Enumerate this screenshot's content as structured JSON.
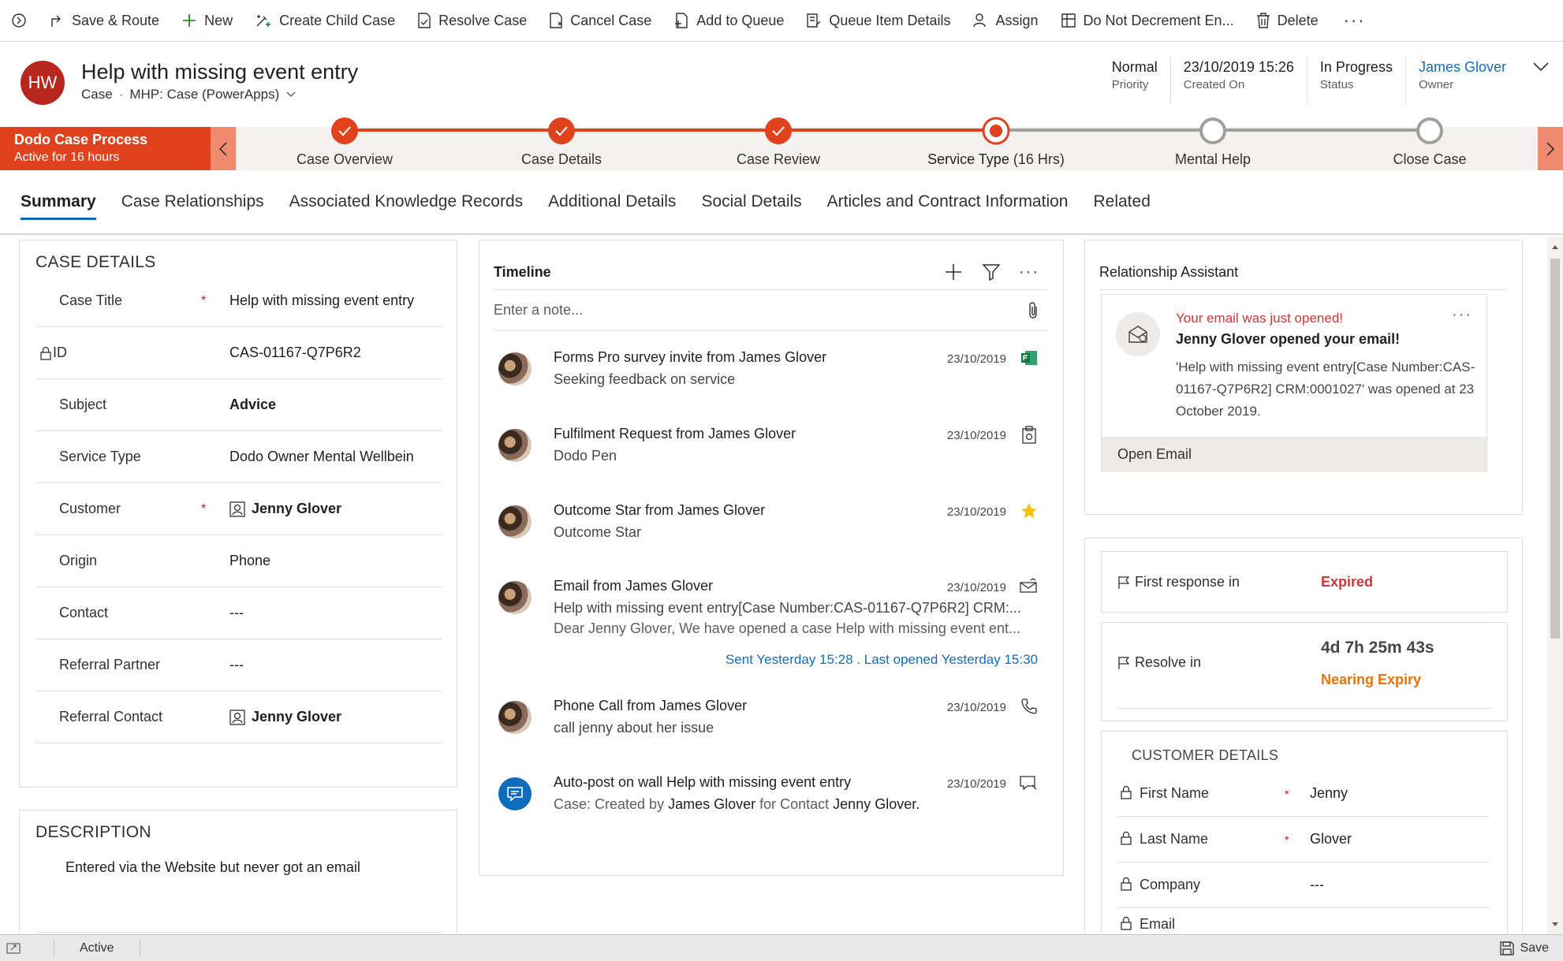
{
  "command_bar": {
    "items": [
      {
        "label": "Save & Route",
        "icon": "route-icon"
      },
      {
        "label": "New",
        "icon": "plus-icon"
      },
      {
        "label": "Create Child Case",
        "icon": "child-case-icon"
      },
      {
        "label": "Resolve Case",
        "icon": "resolve-icon"
      },
      {
        "label": "Cancel Case",
        "icon": "cancel-case-icon"
      },
      {
        "label": "Add to Queue",
        "icon": "queue-icon"
      },
      {
        "label": "Queue Item Details",
        "icon": "queue-details-icon"
      },
      {
        "label": "Assign",
        "icon": "assign-icon"
      },
      {
        "label": "Do Not Decrement En...",
        "icon": "grid-icon"
      },
      {
        "label": "Delete",
        "icon": "trash-icon"
      }
    ],
    "more": "···"
  },
  "header": {
    "avatar_initials": "HW",
    "title": "Help with missing event entry",
    "entity": "Case",
    "form": "MHP: Case (PowerApps)",
    "fields": [
      {
        "value": "Normal",
        "label": "Priority"
      },
      {
        "value": "23/10/2019 15:26",
        "label": "Created On"
      },
      {
        "value": "In Progress",
        "label": "Status"
      },
      {
        "value": "James Glover",
        "label": "Owner"
      }
    ]
  },
  "process": {
    "name": "Dodo Case Process",
    "status": "Active for 16 hours",
    "stages": [
      {
        "label": "Case Overview",
        "state": "done"
      },
      {
        "label": "Case Details",
        "state": "done"
      },
      {
        "label": "Case Review",
        "state": "done"
      },
      {
        "label": "Service Type",
        "duration": "(16 Hrs)",
        "state": "active"
      },
      {
        "label": "Mental Help",
        "state": "pending"
      },
      {
        "label": "Close Case",
        "state": "pending"
      }
    ]
  },
  "tabs": [
    "Summary",
    "Case Relationships",
    "Associated Knowledge Records",
    "Additional Details",
    "Social Details",
    "Articles and Contract Information",
    "Related"
  ],
  "case_details": {
    "title": "CASE DETAILS",
    "rows": [
      {
        "label": "Case Title",
        "required": "*",
        "value": "Help with missing event entry"
      },
      {
        "label": "ID",
        "required": "",
        "value": "CAS-01167-Q7P6R2"
      },
      {
        "label": "Subject",
        "required": "",
        "value": "Advice"
      },
      {
        "label": "Service Type",
        "required": "",
        "value": "Dodo Owner Mental Wellbein"
      },
      {
        "label": "Customer",
        "required": "*",
        "value": "Jenny Glover"
      },
      {
        "label": "Origin",
        "required": "",
        "value": "Phone"
      },
      {
        "label": "Contact",
        "required": "",
        "value": "---"
      },
      {
        "label": "Referral Partner",
        "required": "",
        "value": "---"
      },
      {
        "label": "Referral Contact",
        "required": "",
        "value": "Jenny Glover"
      }
    ]
  },
  "description": {
    "title": "DESCRIPTION",
    "text": "Entered via the Website but never got an email"
  },
  "timeline": {
    "title": "Timeline",
    "note_placeholder": "Enter a note...",
    "items": [
      {
        "title": "Forms Pro survey invite from James Glover",
        "sub": "Seeking feedback on service",
        "date": "23/10/2019",
        "icon": "forms-pro-icon"
      },
      {
        "title": "Fulfilment Request from James Glover",
        "sub": "Dodo Pen",
        "date": "23/10/2019",
        "icon": "clipboard-icon"
      },
      {
        "title": "Outcome Star from James Glover",
        "sub": "Outcome Star",
        "date": "23/10/2019",
        "icon": "star-icon"
      },
      {
        "title": "Email from James Glover",
        "sub": "Help with missing event entry[Case Number:CAS-01167-Q7P6R2] CRM:...",
        "sub2": "Dear Jenny Glover, We have opened a case Help with missing event ent...",
        "meta": "Sent Yesterday 15:28 . Last opened Yesterday 15:30",
        "date": "23/10/2019",
        "icon": "email-icon"
      },
      {
        "title": "Phone Call from James Glover",
        "sub": "call jenny about her issue",
        "date": "23/10/2019",
        "icon": "phone-icon"
      },
      {
        "title": "Auto-post on wall Help with missing event entry",
        "sub_prefix": "Case: Created by ",
        "sub_name1": "James Glover",
        "sub_mid": " for Contact ",
        "sub_name2": "Jenny Glover.",
        "date": "23/10/2019",
        "icon": "post-icon"
      }
    ]
  },
  "relationship_assistant": {
    "title": "Relationship Assistant",
    "alert": "Your email was just opened!",
    "headline": "Jenny Glover opened your email!",
    "body": "'Help with missing event entry[Case Number:CAS-01167-Q7P6R2] CRM:0001027' was opened at 23 October 2019.",
    "action": "Open Email",
    "more": "···"
  },
  "sla": {
    "first_response": {
      "label": "First response in",
      "value": "Expired",
      "color": "#d13438"
    },
    "resolve": {
      "label": "Resolve in",
      "timer": "4d 7h 25m 43s",
      "value": "Nearing Expiry",
      "color": "#e8720c"
    }
  },
  "customer_details": {
    "title": "CUSTOMER DETAILS",
    "rows": [
      {
        "label": "First Name",
        "required": "*",
        "value": "Jenny"
      },
      {
        "label": "Last Name",
        "required": "*",
        "value": "Glover"
      },
      {
        "label": "Company",
        "required": "",
        "value": "---"
      },
      {
        "label": "Email",
        "required": "",
        "value": ""
      }
    ]
  },
  "footer": {
    "status": "Active",
    "save": "Save"
  },
  "colors": {
    "accent": "#0f6cbd",
    "process": "#e0421e",
    "avatar": "#b8271e"
  }
}
